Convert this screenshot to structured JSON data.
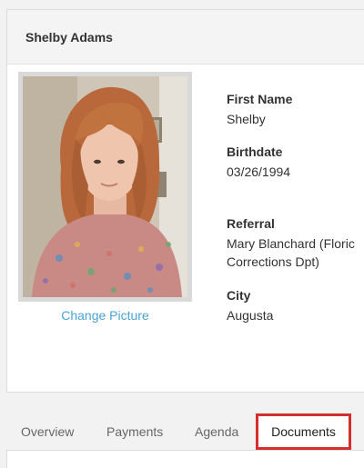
{
  "profile": {
    "name": "Shelby Adams",
    "change_picture": "Change Picture",
    "photo_alt": "profile-photo"
  },
  "fields": {
    "first_name": {
      "label": "First Name",
      "value": "Shelby"
    },
    "birthdate": {
      "label": "Birthdate",
      "value": "03/26/1994"
    },
    "referral": {
      "label": "Referral",
      "line1": "Mary Blanchard (Floric",
      "line2": "Corrections Dpt)"
    },
    "city": {
      "label": "City",
      "value": "Augusta"
    }
  },
  "tabs": [
    {
      "label": "Overview"
    },
    {
      "label": "Payments"
    },
    {
      "label": "Agenda"
    },
    {
      "label": "Documents",
      "active": true
    }
  ],
  "colors": {
    "link": "#4aa3d6",
    "highlight_border": "#d32f2f"
  }
}
